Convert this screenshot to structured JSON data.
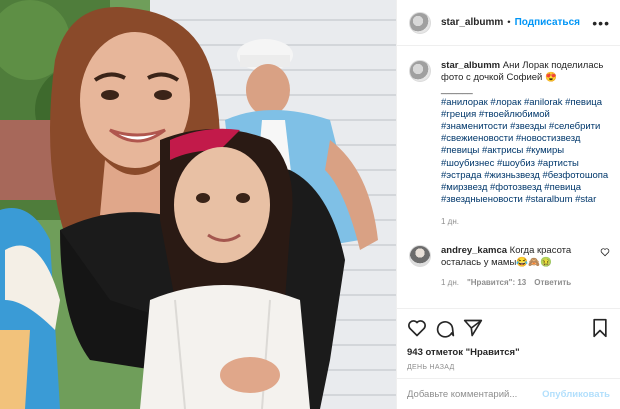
{
  "post": {
    "username": "star_albumm",
    "follow_label": "Подписаться",
    "dot": "•",
    "more_icon": "more-horizontal-icon"
  },
  "caption": {
    "username": "star_albumm",
    "text": "Ани Лорак поделилась фото с дочкой Софией 😍",
    "separator": "______",
    "hashtags": "#анилорак #лорак #anilorak #певица #греция #твоейлюбимой #знаменитости #звезды #селебрити #свежиеновости #новостизвезд #певицы #актрисы #кумиры #шоубизнес #шоубиз #артисты #эстрада #жизньзвезд #безфотошопа #мирзвезд #фотозвезд #певица #звездныеновости #staralbum #star",
    "time": "1 дн."
  },
  "reply": {
    "username": "andrey_kamca",
    "text": "Когда красота осталась у мамы😂🙈🤢",
    "time": "1 дн.",
    "likes": "\"Нравится\": 13",
    "reply_label": "Ответить"
  },
  "actions": {
    "likes": "943 отметок \"Нравится\"",
    "date": "ДЕНЬ НАЗАД"
  },
  "comment_box": {
    "placeholder": "Добавьте комментарий...",
    "post_label": "Опубликовать"
  },
  "colors": {
    "link": "#0095f6",
    "hashtag": "#00376b",
    "muted": "#8e8e8e",
    "border": "#efefef",
    "post_disabled": "#b2dffc"
  }
}
